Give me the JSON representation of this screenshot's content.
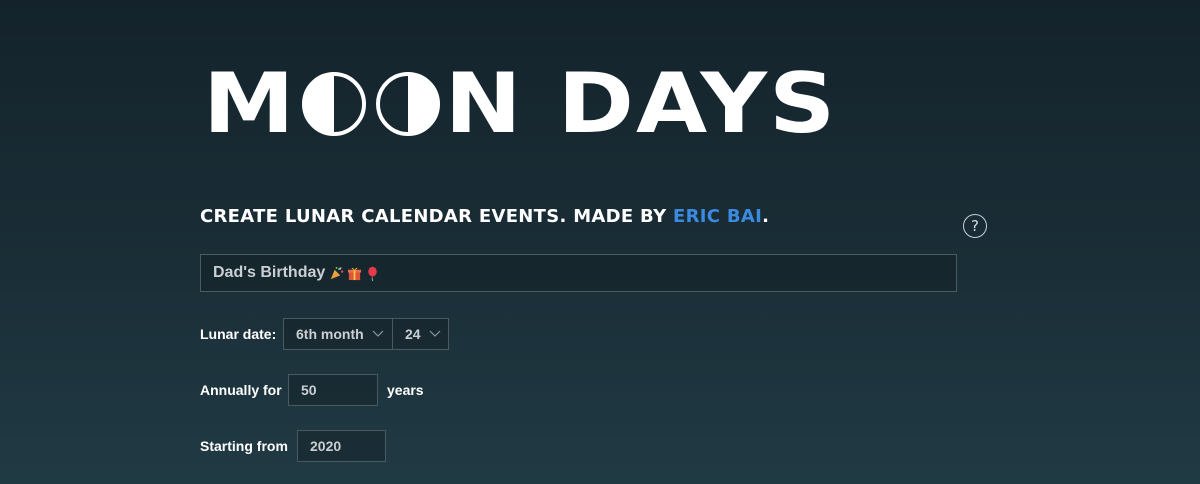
{
  "logo": {
    "text_start": "M",
    "text_end": "N DAYS"
  },
  "tagline": {
    "text": "CREATE LUNAR CALENDAR EVENTS. MADE BY ",
    "author_link": "ERIC BAI",
    "suffix": "."
  },
  "help": {
    "label": "?"
  },
  "event": {
    "value": "Dad's Birthday",
    "emojis": [
      "party-popper-icon",
      "gift-icon",
      "balloon-icon"
    ]
  },
  "lunar_date": {
    "label": "Lunar date:",
    "month_value": "6th month",
    "day_value": "24"
  },
  "annually": {
    "label": "Annually for",
    "value": "50",
    "suffix": "years"
  },
  "starting": {
    "label": "Starting from",
    "value": "2020"
  },
  "colors": {
    "link": "#3a8ae0",
    "background_top": "#14232b",
    "background_bottom": "#203a44"
  }
}
